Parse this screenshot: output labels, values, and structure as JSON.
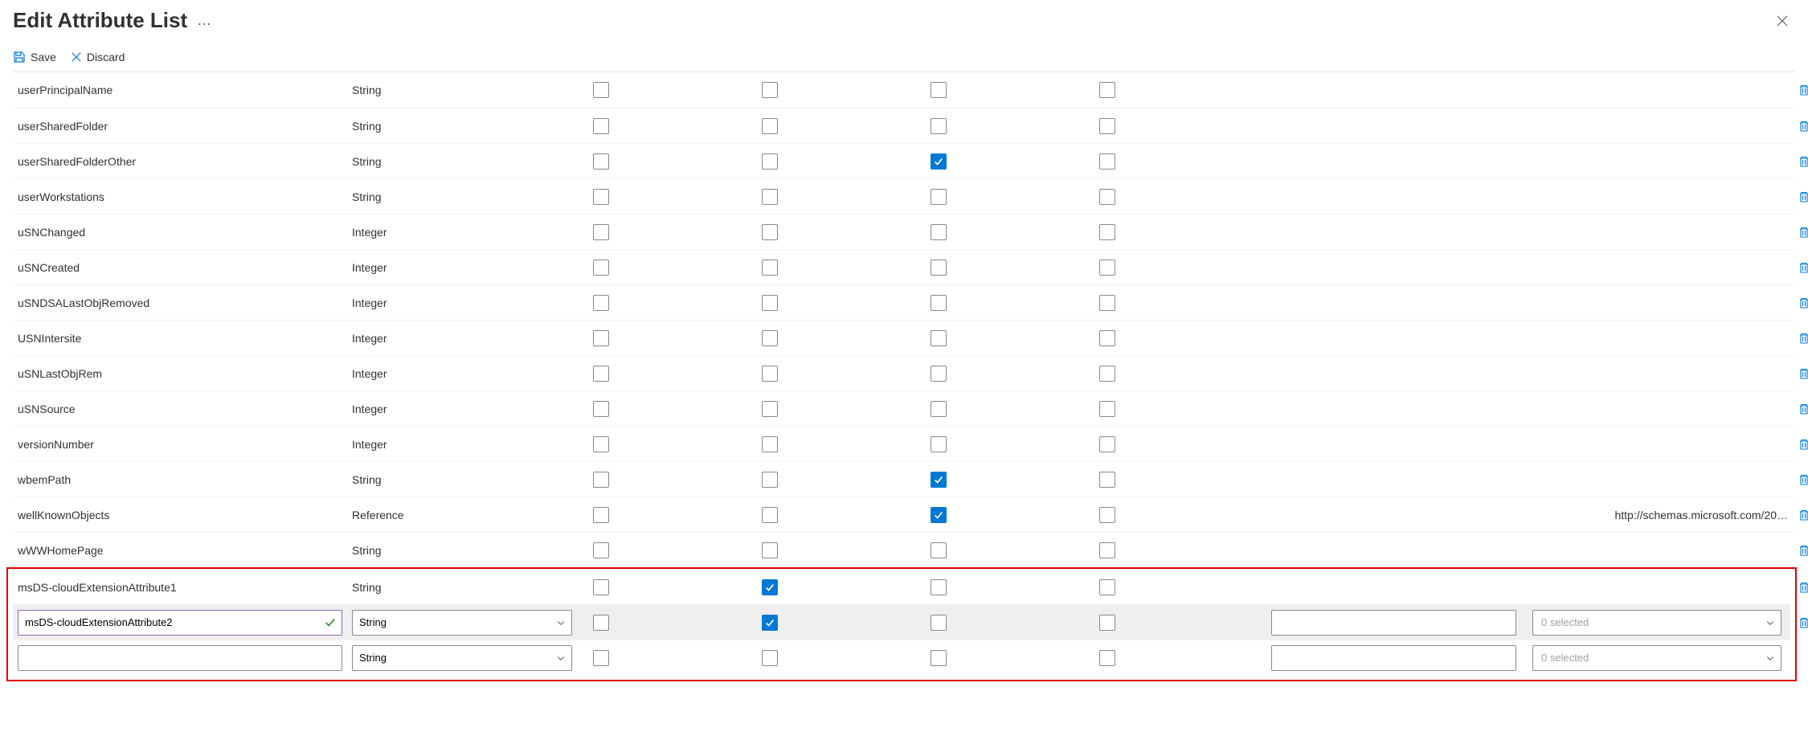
{
  "header": {
    "title": "Edit Attribute List"
  },
  "toolbar": {
    "save_label": "Save",
    "discard_label": "Discard"
  },
  "rows": [
    {
      "name": "userPrincipalName",
      "type": "String",
      "c1": false,
      "c2": false,
      "c3": false,
      "c4": false,
      "extra_text": ""
    },
    {
      "name": "userSharedFolder",
      "type": "String",
      "c1": false,
      "c2": false,
      "c3": false,
      "c4": false,
      "extra_text": ""
    },
    {
      "name": "userSharedFolderOther",
      "type": "String",
      "c1": false,
      "c2": false,
      "c3": true,
      "c4": false,
      "extra_text": ""
    },
    {
      "name": "userWorkstations",
      "type": "String",
      "c1": false,
      "c2": false,
      "c3": false,
      "c4": false,
      "extra_text": ""
    },
    {
      "name": "uSNChanged",
      "type": "Integer",
      "c1": false,
      "c2": false,
      "c3": false,
      "c4": false,
      "extra_text": ""
    },
    {
      "name": "uSNCreated",
      "type": "Integer",
      "c1": false,
      "c2": false,
      "c3": false,
      "c4": false,
      "extra_text": ""
    },
    {
      "name": "uSNDSALastObjRemoved",
      "type": "Integer",
      "c1": false,
      "c2": false,
      "c3": false,
      "c4": false,
      "extra_text": ""
    },
    {
      "name": "USNIntersite",
      "type": "Integer",
      "c1": false,
      "c2": false,
      "c3": false,
      "c4": false,
      "extra_text": ""
    },
    {
      "name": "uSNLastObjRem",
      "type": "Integer",
      "c1": false,
      "c2": false,
      "c3": false,
      "c4": false,
      "extra_text": ""
    },
    {
      "name": "uSNSource",
      "type": "Integer",
      "c1": false,
      "c2": false,
      "c3": false,
      "c4": false,
      "extra_text": ""
    },
    {
      "name": "versionNumber",
      "type": "Integer",
      "c1": false,
      "c2": false,
      "c3": false,
      "c4": false,
      "extra_text": ""
    },
    {
      "name": "wbemPath",
      "type": "String",
      "c1": false,
      "c2": false,
      "c3": true,
      "c4": false,
      "extra_text": ""
    },
    {
      "name": "wellKnownObjects",
      "type": "Reference",
      "c1": false,
      "c2": false,
      "c3": true,
      "c4": false,
      "extra_text": "http://schemas.microsoft.com/20…"
    },
    {
      "name": "wWWHomePage",
      "type": "String",
      "c1": false,
      "c2": false,
      "c3": false,
      "c4": false,
      "extra_text": ""
    }
  ],
  "highlighted": {
    "row_a": {
      "name": "msDS-cloudExtensionAttribute1",
      "type": "String",
      "c1": false,
      "c2": true,
      "c3": false,
      "c4": false
    },
    "row_b": {
      "name_value": "msDS-cloudExtensionAttribute2",
      "type_value": "String",
      "c1": false,
      "c2": true,
      "c3": false,
      "c4": false,
      "multi_label": "0 selected"
    },
    "row_c": {
      "name_value": "",
      "type_value": "String",
      "c1": false,
      "c2": false,
      "c3": false,
      "c4": false,
      "multi_label": "0 selected"
    }
  }
}
